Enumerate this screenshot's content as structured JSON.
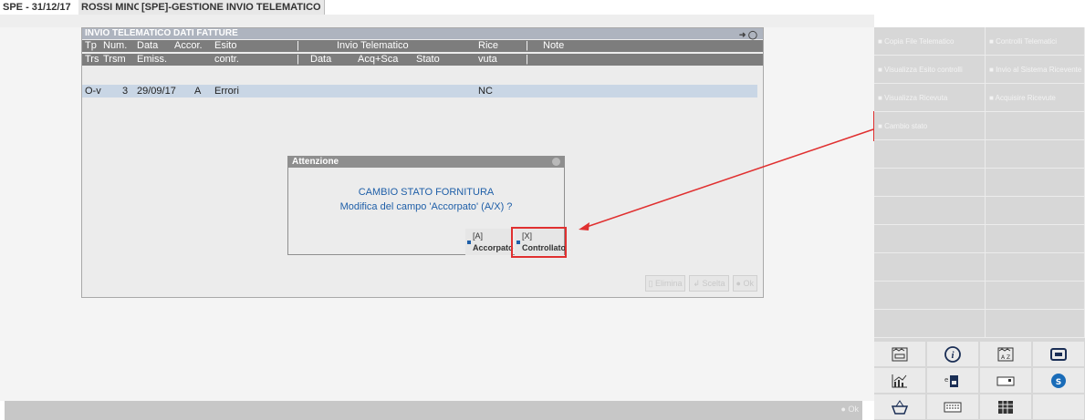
{
  "title_bar": {
    "seg1": "SPE - 31/12/17",
    "seg2": "ROSSI MINO",
    "seg3": "[SPE]-GESTIONE INVIO TELEMATICO"
  },
  "window": {
    "title": "INVIO TELEMATICO DATI FATTURE",
    "header1": [
      "Tp",
      "Num.",
      "Data",
      "Accor.",
      "Esito",
      "|",
      "Invio Telematico",
      "Rice",
      "|",
      "Note"
    ],
    "header2": [
      "Trs",
      "Trsm",
      "Emiss.",
      "contr.",
      "|",
      "Data",
      "Acq+Sca",
      "Stato",
      "vuta",
      "|"
    ],
    "row": {
      "tp": "O-v",
      "num": "3",
      "data": "29/09/17",
      "accor": "A",
      "esito": "Errori",
      "rice": "NC"
    },
    "buttons": {
      "elimina": "Elimina",
      "scelta": "Scelta",
      "ok": "Ok"
    }
  },
  "dialog": {
    "title": "Attenzione",
    "line1": "CAMBIO STATO FORNITURA",
    "line2": "Modifica del campo 'Accorpato' (A/X) ?",
    "btn_a_key": "[A]",
    "btn_a_label": "Accorpato",
    "btn_x_key": "[X]",
    "btn_x_label": "Controllato"
  },
  "bottom": {
    "ok": "Ok"
  },
  "right_panel": {
    "r1c1": "Copia File Telematico",
    "r1c2": "Controlli Telematici",
    "r2c1": "Visualizza Esito controlli",
    "r2c2": "Invio al Sistema Ricevente",
    "r3c1": "Visualizza Ricevuta",
    "r3c2": "Acquisire Ricevute",
    "r4c1": "Cambio stato",
    "icons": [
      "file-list-icon",
      "info-icon",
      "sort-az-icon",
      "play-icon",
      "chart-icon",
      "lock-doc-icon",
      "keyboard-small-icon",
      "sw-icon",
      "basket-icon",
      "keyboard-icon",
      "calculator-icon"
    ]
  },
  "colors": {
    "accent_blue": "#1f5fa8",
    "highlight_red": "#e03030"
  }
}
